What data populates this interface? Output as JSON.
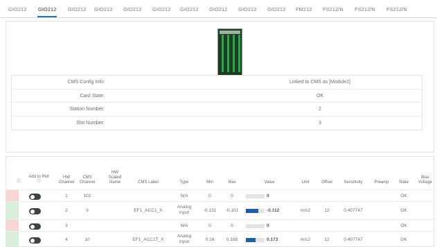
{
  "tabs": [
    {
      "label": "GIO212",
      "active": false
    },
    {
      "label": "GIO212",
      "active": true
    },
    {
      "label": "GIO212",
      "active": false
    },
    {
      "label": "GIO212",
      "active": false
    },
    {
      "label": "GIO212",
      "active": false
    },
    {
      "label": "GIO212",
      "active": false
    },
    {
      "label": "GIO212",
      "active": false
    },
    {
      "label": "GIO212",
      "active": false
    },
    {
      "label": "GIO212",
      "active": false
    },
    {
      "label": "GIO212",
      "active": false
    },
    {
      "label": "FM212",
      "active": false
    },
    {
      "label": "FS212/N",
      "active": false
    },
    {
      "label": "FS212/N",
      "active": false
    },
    {
      "label": "FS212/N",
      "active": false
    }
  ],
  "card_info": [
    {
      "label": "CMS Config Info:",
      "value": "Linked to CMS as [Module2]"
    },
    {
      "label": "Card State:",
      "value": "OK"
    },
    {
      "label": "Station Number:",
      "value": "2"
    },
    {
      "label": "Slot Number:",
      "value": "3"
    }
  ],
  "table": {
    "headers": {
      "info": "ⓘ",
      "add_to_plot": "Add to Plot ⓘ",
      "hw_channel": "HW Channel",
      "cms_channel": "CMS Channel",
      "hw_scaled_name": "HW Scaled Name",
      "cms_label": "CMS Label",
      "type": "Type",
      "min": "Min",
      "max": "Max",
      "value": "Value",
      "unit": "Unit",
      "offset": "Offset",
      "sensitivity": "Sensitivity",
      "preamp": "Preamp",
      "state": "State",
      "bias_voltage": "Bias Voltage"
    },
    "rows": [
      {
        "indicator": "#f7d6d6",
        "hw_channel": "1",
        "cms_channel": "102",
        "cms_label": "",
        "type": "N/A",
        "min": "0",
        "max": "0",
        "value": "0",
        "value_fraction": 0,
        "unit": "",
        "offset": "",
        "sensitivity": "",
        "state": "OK"
      },
      {
        "indicator": "#d9efd9",
        "hw_channel": "2",
        "cms_channel": "9",
        "cms_label": "EF1_ACC1_X",
        "type": "Analog input",
        "min": "-0.131",
        "max": "-0.102",
        "value": "-0.112",
        "value_fraction": 0.65,
        "unit": "m/s2",
        "offset": "12",
        "sensitivity": "0.407747",
        "state": "OK"
      },
      {
        "indicator": "#f7d6d6",
        "hw_channel": "3",
        "cms_channel": "",
        "cms_label": "",
        "type": "N/A",
        "min": "0",
        "max": "0",
        "value": "0",
        "value_fraction": 0,
        "unit": "",
        "offset": "",
        "sensitivity": "",
        "state": "OK"
      },
      {
        "indicator": "#d9efd9",
        "hw_channel": "4",
        "cms_channel": "10",
        "cms_label": "EF1_ACC1T_X",
        "type": "Analog input",
        "min": "0.16",
        "max": "0.188",
        "value": "0.172",
        "value_fraction": 0.5,
        "unit": "m/s2",
        "offset": "12",
        "sensitivity": "0.407747",
        "state": "OK"
      }
    ]
  }
}
